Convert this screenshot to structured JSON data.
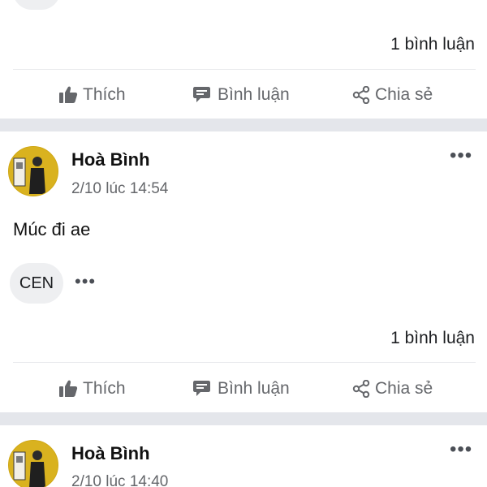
{
  "feed": {
    "actions": {
      "like_label": "Thích",
      "comment_label": "Bình luận",
      "share_label": "Chia sẻ"
    },
    "icons": {
      "like": "thumbs-up-icon",
      "comment": "speech-bubble-icon",
      "share": "share-icon",
      "more": "more-options-icon"
    },
    "colors": {
      "action_text": "#65676b",
      "divider": "#e4e6eb",
      "avatar_bg": "#d9b21f"
    },
    "posts": [
      {
        "comment_count": "1 bình luận"
      },
      {
        "author": "Hoà Bình",
        "time": "2/10 lúc 14:54",
        "text": "Múc đi ae",
        "tag": "CEN",
        "comment_count": "1 bình luận"
      },
      {
        "author": "Hoà Bình",
        "time": "2/10 lúc 14:40"
      }
    ]
  }
}
